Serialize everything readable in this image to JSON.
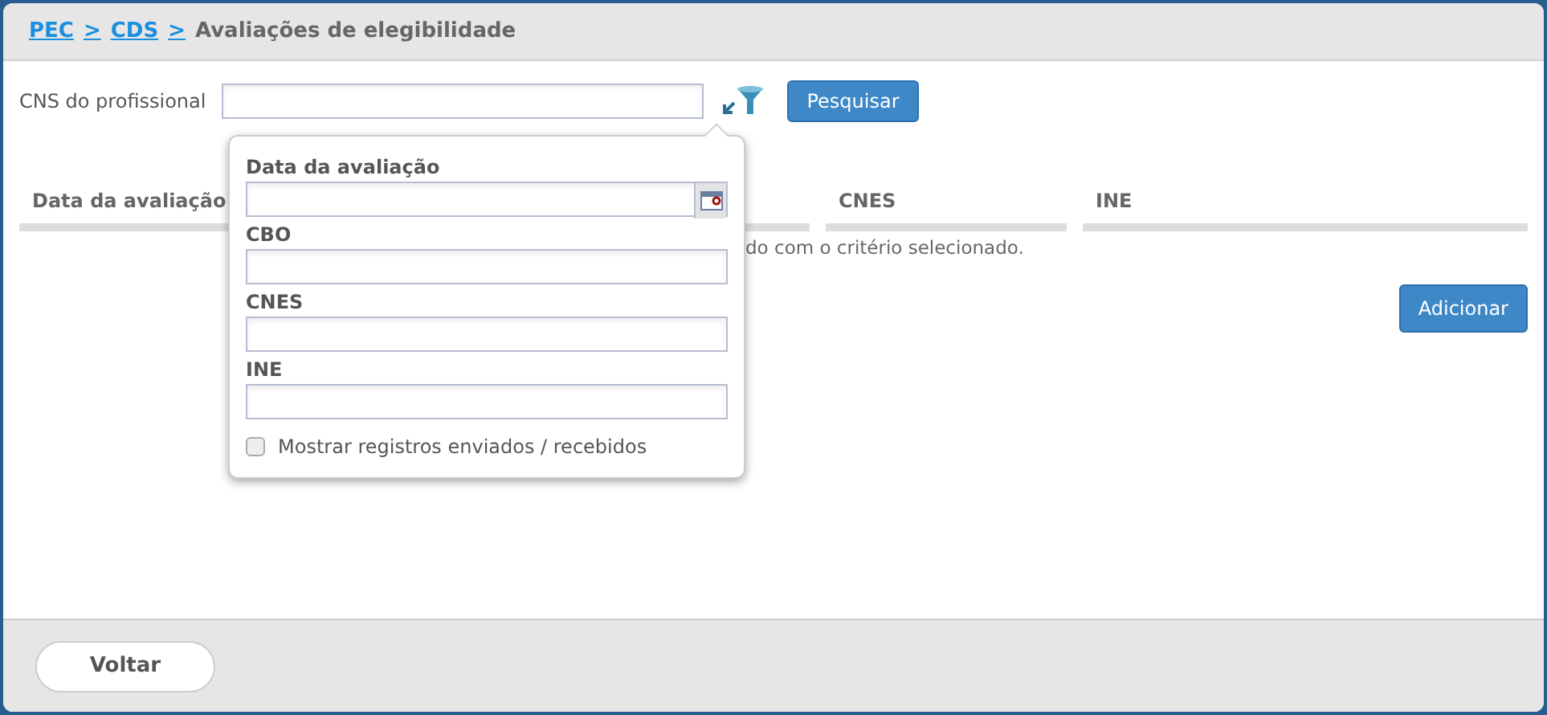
{
  "breadcrumb": [
    {
      "label": "PEC",
      "link": true
    },
    {
      "label": ">",
      "link": true
    },
    {
      "label": "CDS",
      "link": true
    },
    {
      "label": ">",
      "link": true
    },
    {
      "label": "Avaliações de elegibilidade",
      "link": false
    }
  ],
  "search": {
    "label": "CNS do profissional",
    "button": "Pesquisar"
  },
  "table": {
    "columns": [
      {
        "label": "Data da avaliação"
      },
      {},
      {
        "label": "CNES"
      },
      {
        "label": "INE"
      }
    ],
    "empty_message": "do com o critério selecionado."
  },
  "add_button": "Adicionar",
  "filter_popover": {
    "fields": [
      {
        "label": "Data da avaliação",
        "kind": "date"
      },
      {
        "label": "CBO",
        "kind": "text"
      },
      {
        "label": "CNES",
        "kind": "text"
      },
      {
        "label": "INE",
        "kind": "text"
      }
    ],
    "checkbox": {
      "label": "Mostrar registros enviados / recebidos",
      "checked": false
    }
  },
  "footer": {
    "button": "Voltar"
  }
}
